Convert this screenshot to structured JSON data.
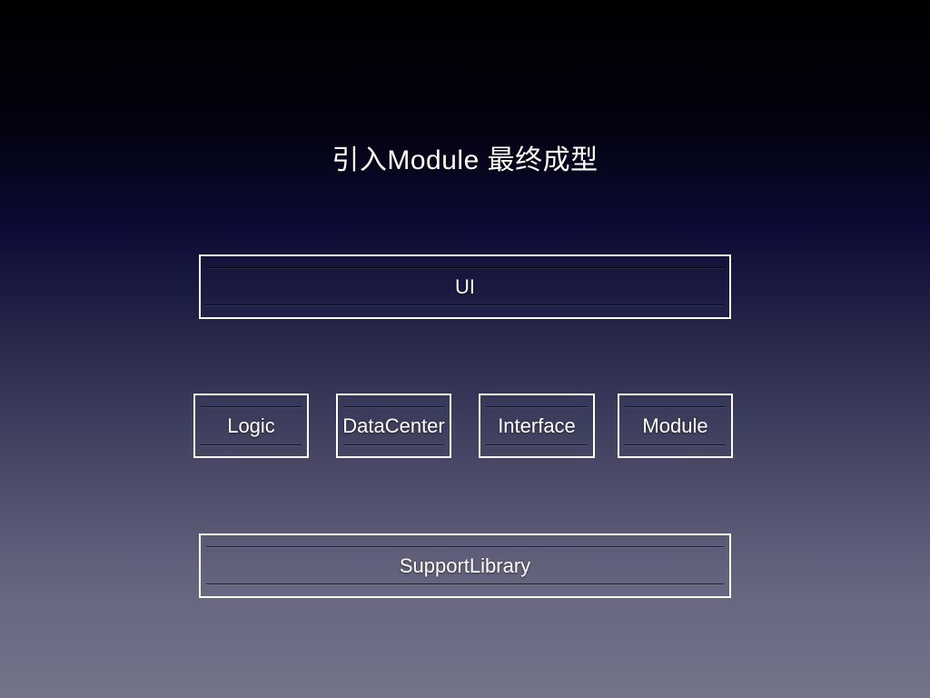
{
  "slide": {
    "title": "引入Module 最终成型",
    "layers": {
      "top": {
        "label": "UI"
      },
      "middle": [
        {
          "label": "Logic"
        },
        {
          "label": "DataCenter"
        },
        {
          "label": "Interface"
        },
        {
          "label": "Module"
        }
      ],
      "bottom": {
        "label": "SupportLibrary"
      }
    }
  },
  "colors": {
    "box_border": "#ffffff",
    "text": "#ffffff",
    "background_top": "#000000",
    "background_mid": "#0b0b35",
    "background_bottom": "#737389"
  }
}
